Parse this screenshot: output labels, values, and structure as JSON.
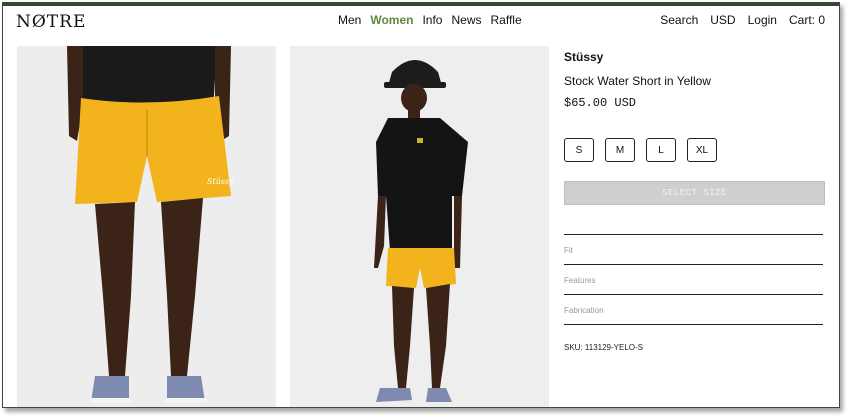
{
  "header": {
    "logo": "NØTRE",
    "nav": [
      "Men",
      "Women",
      "Info",
      "News",
      "Raffle"
    ],
    "active_nav": "Women",
    "right": [
      "Search",
      "USD",
      "Login",
      "Cart: 0"
    ]
  },
  "product": {
    "brand": "Stüssy",
    "name": "Stock Water Short in Yellow",
    "price": "$65.00 USD",
    "sizes": [
      "S",
      "M",
      "L",
      "XL"
    ],
    "select_label": "SELECT SIZE",
    "accordion": [
      "Fit",
      "Features",
      "Fabrication"
    ],
    "sku": "SKU: 113129-YELO-S"
  },
  "colors": {
    "accent": "#5c8a3f",
    "topbar": "#2f4a2a",
    "shorts": "#f2b31d"
  }
}
